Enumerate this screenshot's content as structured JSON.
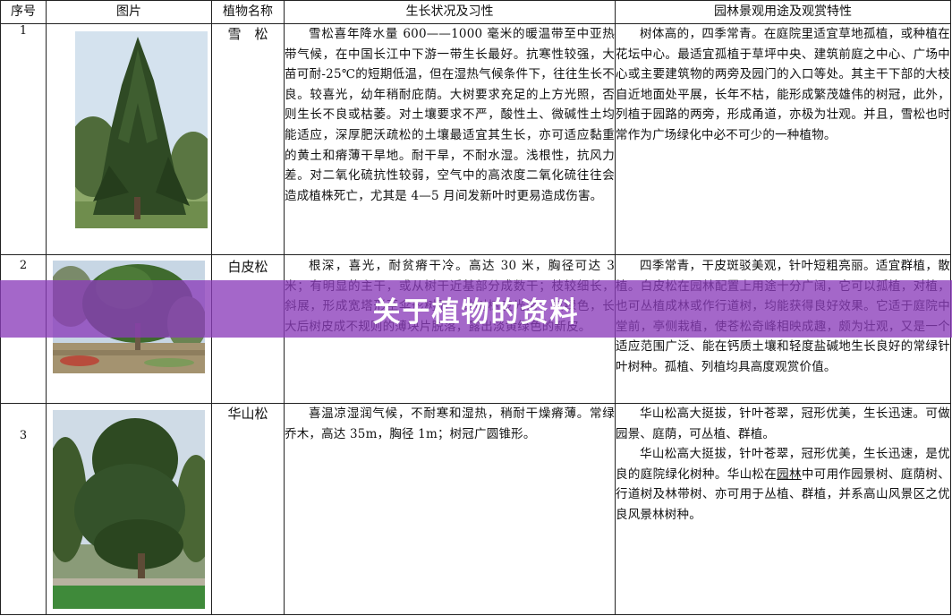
{
  "table": {
    "headers": {
      "index": "序号",
      "image": "图片",
      "name": "植物名称",
      "growth": "生长状况及习性",
      "landscape": "园林景观用途及观赏特性"
    },
    "rows": [
      {
        "index": "1",
        "name": "雪　松",
        "growth": "雪松喜年降水量 600——1000 毫米的暖温带至中亚热带气候，在中国长江中下游一带生长最好。抗寒性较强，大苗可耐-25℃的短期低温，但在湿热气候条件下，往往生长不良。较喜光，幼年稍耐庇荫。大树要求充足的上方光照，否则生长不良或枯萎。对土壤要求不严，酸性土、微碱性土均能适应，深厚肥沃疏松的土壤最适宜其生长，亦可适应黏重的黄土和瘠薄干旱地。耐干旱，不耐水湿。浅根性，抗风力差。对二氧化硫抗性较弱，空气中的高浓度二氧化硫往往会造成植株死亡，尤其是 4—5 月间发新叶时更易造成伤害。",
        "landscape": "树体高的，四季常青。在庭院里适宜草地孤植，或种植在花坛中心。最适宜孤植于草坪中央、建筑前庭之中心、广场中心或主要建筑物的两旁及园门的入口等处。其主干下部的大枝自近地面处平展，长年不枯，能形成繁茂雄伟的树冠，此外，列植于园路的两旁，形成甬道，亦极为壮观。并且，雪松也时常作为广场绿化中必不可少的一种植物。"
      },
      {
        "index": "2",
        "name": "白皮松",
        "growth": "根深，喜光，耐贫瘠干冷。高达 30 米，胸径可达 3 米；有明显的主干，或从树干近基部分成数干；枝较细长，斜展，形成宽塔形至伞形树冠；幼树树皮光滑，灰绿色，长大后树皮成不规则的薄块片脱落，露出淡黄绿色的新皮。",
        "landscape": "四季常青，干皮斑驳美观，针叶短粗亮丽。适宜群植，散植。白皮松在园林配置上用途十分广阔，它可以孤植，对植，也可丛植成林或作行道树，均能获得良好效果。它适于庭院中堂前，亭侧栽植，使苍松奇峰相映成趣，颇为壮观，又是一个适应范围广泛、能在钙质土壤和轻度盐碱地生长良好的常绿针叶树种。孤植、列植均具高度观赏价值。"
      },
      {
        "index": "3",
        "name": "华山松",
        "growth": "喜温凉湿润气候，不耐寒和湿热，稍耐干燥瘠薄。常绿乔木，高达 35m，胸径 1m；树冠广圆锥形。",
        "landscape_p1": "华山松高大挺拔，针叶苍翠，冠形优美，生长迅速。可做园景、庭荫，可丛植、群植。",
        "landscape_p2_a": "华山松高大挺拔，针叶苍翠，冠形优美，生长迅速，是优良的庭院绿化树种。华山松在",
        "landscape_p2_link": "园林",
        "landscape_p2_b": "中可用作园景树、庭荫树、行道树及林带树、亦可用于丛植、群植，并系高山风景区之优良风景林树种。"
      }
    ]
  },
  "overlay": {
    "title": "关于植物的资料",
    "color": "#8a3cba"
  },
  "colors": {
    "border": "#222222",
    "foliage_dark": "#2f4a24",
    "sky": "#c9d9e8"
  }
}
